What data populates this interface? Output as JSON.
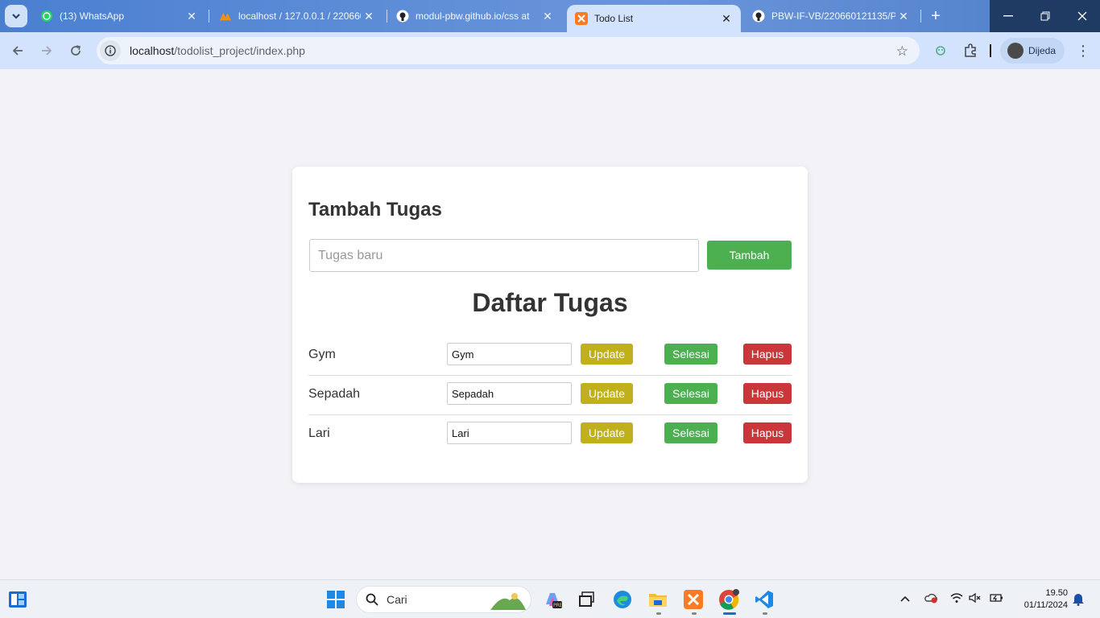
{
  "browser": {
    "tabs": [
      {
        "title": "(13) WhatsApp",
        "icon": "whatsapp-icon",
        "active": false
      },
      {
        "title": "localhost / 127.0.0.1 / 220660",
        "icon": "phpmyadmin-icon",
        "active": false
      },
      {
        "title": "modul-pbw.github.io/css at",
        "icon": "github-icon",
        "active": false
      },
      {
        "title": "Todo List",
        "icon": "xampp-icon",
        "active": true
      },
      {
        "title": "PBW-IF-VB/220660121135/Pr",
        "icon": "github-icon",
        "active": false
      }
    ],
    "address": {
      "host": "localhost",
      "path": "/todolist_project/index.php"
    },
    "profile_name": "Dijeda"
  },
  "page": {
    "add_heading": "Tambah Tugas",
    "input_placeholder": "Tugas baru",
    "add_button": "Tambah",
    "list_heading": "Daftar Tugas",
    "tasks": [
      {
        "name": "Gym",
        "edit_value": "Gym"
      },
      {
        "name": "Sepadah",
        "edit_value": "Sepadah"
      },
      {
        "name": "Lari",
        "edit_value": "Lari"
      }
    ],
    "buttons": {
      "update": "Update",
      "done": "Selesai",
      "delete": "Hapus"
    },
    "colors": {
      "add": "#4caf50",
      "update": "#c0b01c",
      "done": "#4caf50",
      "delete": "#c9373a"
    }
  },
  "taskbar": {
    "search_label": "Cari",
    "time": "19.50",
    "date": "01/11/2024"
  }
}
